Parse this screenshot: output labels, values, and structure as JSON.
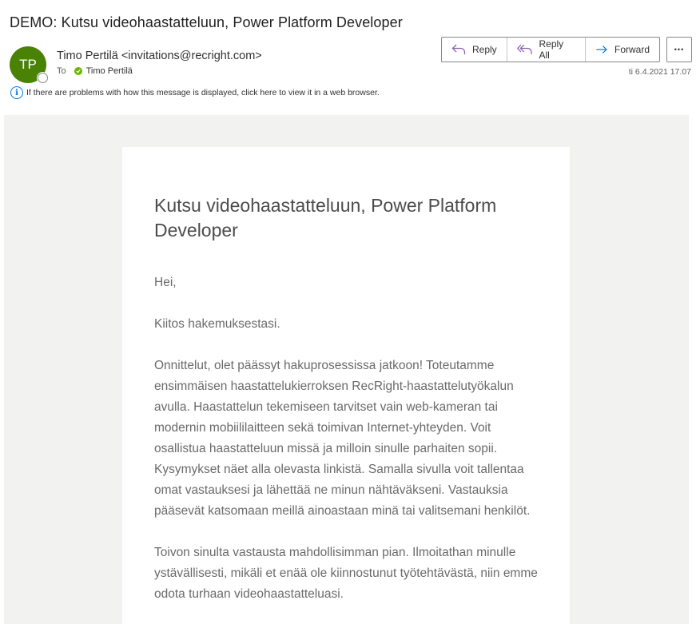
{
  "subject": "DEMO: Kutsu videohaastatteluun, Power Platform Developer",
  "avatar": {
    "initials": "TP",
    "color": "#498205"
  },
  "sender": "Timo Pertilä <invitations@recright.com>",
  "to": {
    "label": "To",
    "recipient": "Timo Pertilä"
  },
  "info_banner": "If there are problems with how this message is displayed, click here to view it in a web browser.",
  "actions": {
    "reply": "Reply",
    "reply_all": "Reply All",
    "forward": "Forward",
    "more": "•••"
  },
  "timestamp": "ti 6.4.2021 17.07",
  "body": {
    "title": "Kutsu videohaastatteluun, Power Platform Developer",
    "greeting": "Hei,",
    "p1": "Kiitos hakemuksestasi.",
    "p2": "Onnittelut, olet päässyt hakuprosessissa jatkoon! Toteutamme ensimmäisen haastattelukierroksen RecRight-haastattelutyökalun avulla. Haastattelun tekemiseen tarvitset vain web-kameran tai modernin mobiililaitteen sekä toimivan Internet-yhteyden. Voit osallistua haastatteluun missä ja milloin sinulle parhaiten sopii. Kysymykset näet alla olevasta linkistä. Samalla sivulla voit tallentaa omat vastauksesi ja lähettää ne minun nähtäväkseni. Vastauksia pääsevät katsomaan meillä ainoastaan minä tai valitsemani henkilöt.",
    "p3": "Toivon sinulta vastausta mahdollisimman pian. Ilmoitathan minulle ystävällisesti, mikäli et enää ole kiinnostunut työtehtävästä, niin emme odota turhaan videohaastatteluasi."
  }
}
